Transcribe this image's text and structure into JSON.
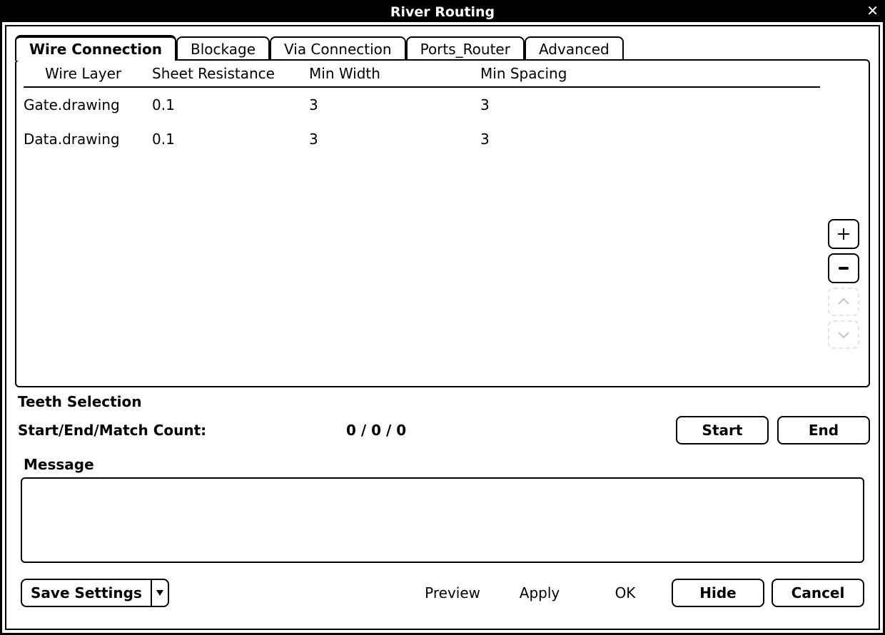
{
  "window": {
    "title": "River Routing"
  },
  "tabs": [
    {
      "label": "Wire Connection",
      "active": true
    },
    {
      "label": "Blockage",
      "active": false
    },
    {
      "label": "Via Connection",
      "active": false
    },
    {
      "label": "Ports_Router",
      "active": false
    },
    {
      "label": "Advanced",
      "active": false
    }
  ],
  "table": {
    "headers": {
      "wire_layer": "Wire Layer",
      "sheet_resistance": "Sheet Resistance",
      "min_width": "Min Width",
      "min_spacing": "Min Spacing"
    },
    "rows": [
      {
        "wire_layer": "Gate.drawing",
        "sheet_resistance": "0.1",
        "min_width": "3",
        "min_spacing": "3"
      },
      {
        "wire_layer": "Data.drawing",
        "sheet_resistance": "0.1",
        "min_width": "3",
        "min_spacing": "3"
      }
    ]
  },
  "teeth": {
    "section_label": "Teeth Selection",
    "count_label": "Start/End/Match Count:",
    "count_value": "0 / 0 / 0",
    "start_btn": "Start",
    "end_btn": "End"
  },
  "message": {
    "label": "Message",
    "content": ""
  },
  "bottom": {
    "save_settings": "Save Settings",
    "preview": "Preview",
    "apply": "Apply",
    "ok": "OK",
    "hide": "Hide",
    "cancel": "Cancel"
  }
}
